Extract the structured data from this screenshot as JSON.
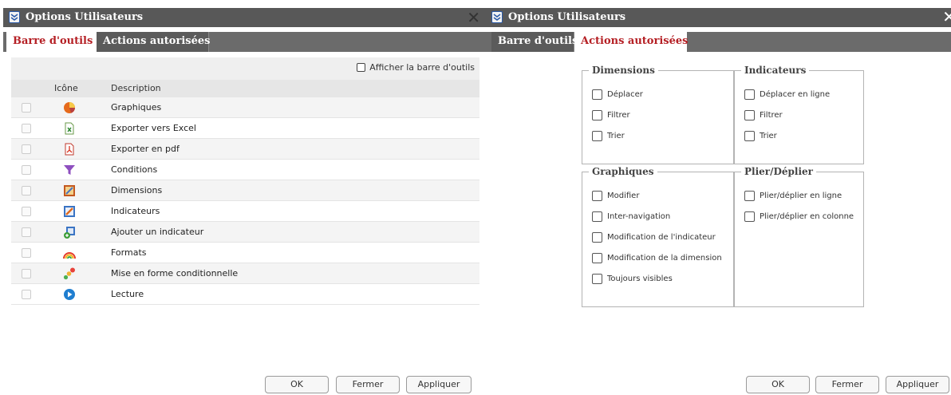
{
  "left_dialog": {
    "title": "Options Utilisateurs",
    "close_label": "✕",
    "tabs": [
      {
        "label": "Barre d'outils",
        "active": true
      },
      {
        "label": "Actions autorisées",
        "active": false
      }
    ],
    "show_toolbar_label": "Afficher la barre d'outils",
    "columns": {
      "icon": "Icône",
      "description": "Description"
    },
    "rows": [
      {
        "icon": "pie-chart-icon",
        "label": "Graphiques"
      },
      {
        "icon": "excel-file-icon",
        "label": "Exporter vers Excel"
      },
      {
        "icon": "pdf-file-icon",
        "label": "Exporter en pdf"
      },
      {
        "icon": "filter-funnel-icon",
        "label": "Conditions"
      },
      {
        "icon": "dimensions-icon",
        "label": "Dimensions"
      },
      {
        "icon": "indicators-icon",
        "label": "Indicateurs"
      },
      {
        "icon": "add-indicator-icon",
        "label": "Ajouter un indicateur"
      },
      {
        "icon": "rainbow-icon",
        "label": "Formats"
      },
      {
        "icon": "conditional-format-icon",
        "label": "Mise en forme conditionnelle"
      },
      {
        "icon": "play-icon",
        "label": "Lecture"
      }
    ],
    "buttons": {
      "ok": "OK",
      "close": "Fermer",
      "apply": "Appliquer"
    }
  },
  "right_dialog": {
    "title": "Options Utilisateurs",
    "close_label": "✕",
    "tabs": [
      {
        "label": "Barre d'outils",
        "active": false
      },
      {
        "label": "Actions autorisées",
        "active": true
      }
    ],
    "groups": {
      "dimensions": {
        "title": "Dimensions",
        "options": [
          "Déplacer",
          "Filtrer",
          "Trier"
        ]
      },
      "indicateurs": {
        "title": "Indicateurs",
        "options": [
          "Déplacer en ligne",
          "Filtrer",
          "Trier"
        ]
      },
      "graphiques": {
        "title": "Graphiques",
        "options": [
          "Modifier",
          "Inter-navigation",
          "Modification de l'indicateur",
          "Modification de la dimension",
          "Toujours visibles"
        ]
      },
      "plier": {
        "title": "Plier/Déplier",
        "options": [
          "Plier/déplier en ligne",
          "Plier/déplier en colonne"
        ]
      }
    },
    "buttons": {
      "ok": "OK",
      "close": "Fermer",
      "apply": "Appliquer"
    }
  },
  "colors": {
    "titlebar": "#585858",
    "tabbar": "#6b6b6b",
    "active_tab_text": "#b52025"
  }
}
